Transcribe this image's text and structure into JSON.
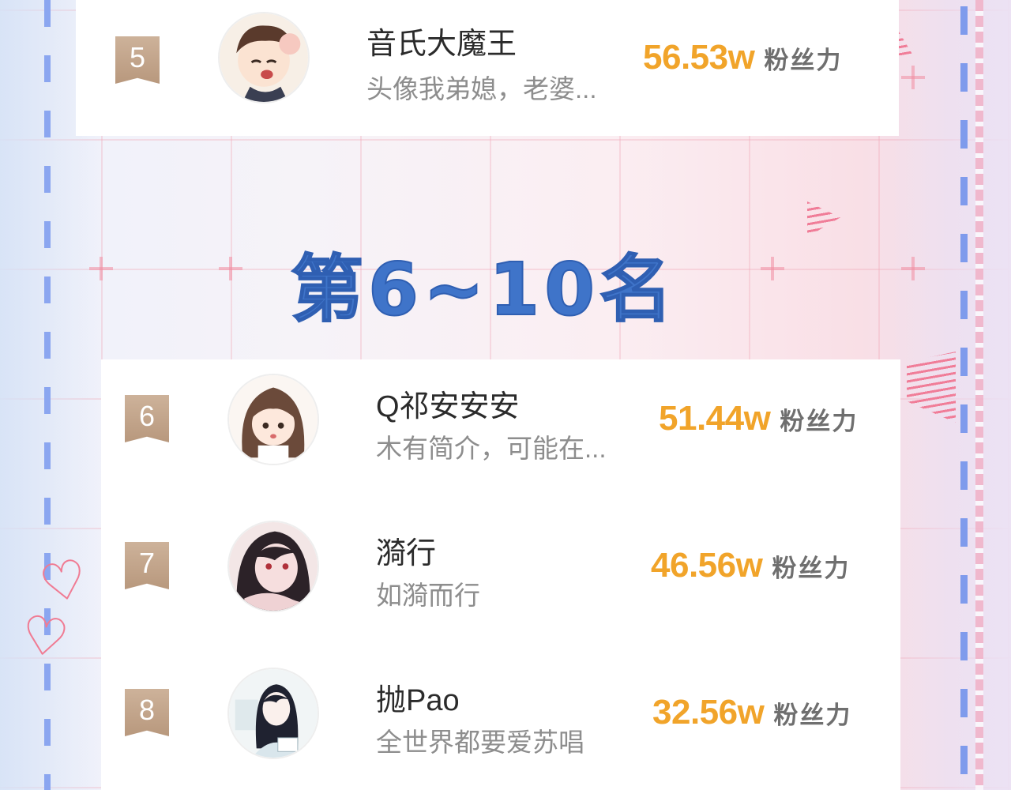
{
  "section_title": "第6~10名",
  "score_unit": "粉丝力",
  "entries": [
    {
      "rank": "5",
      "name": "音氏大魔王",
      "bio": "头像我弟媳，老婆...",
      "score": "56.53w",
      "avatar": "avatar-boy-cartoon"
    },
    {
      "rank": "6",
      "name": "Q祁安安安",
      "bio": "木有简介，可能在...",
      "score": "51.44w",
      "avatar": "avatar-girl-cartoon"
    },
    {
      "rank": "7",
      "name": "漪行",
      "bio": "如漪而行",
      "score": "46.56w",
      "avatar": "avatar-dark-hair-girl"
    },
    {
      "rank": "8",
      "name": "抛Pao",
      "bio": "全世界都要爱苏唱",
      "score": "32.56w",
      "avatar": "avatar-sketch-girl"
    }
  ],
  "colors": {
    "score": "#f1a42a",
    "title": "#3f74c9",
    "badge": "#c4a68c",
    "dashes": "#8ba6f0"
  }
}
